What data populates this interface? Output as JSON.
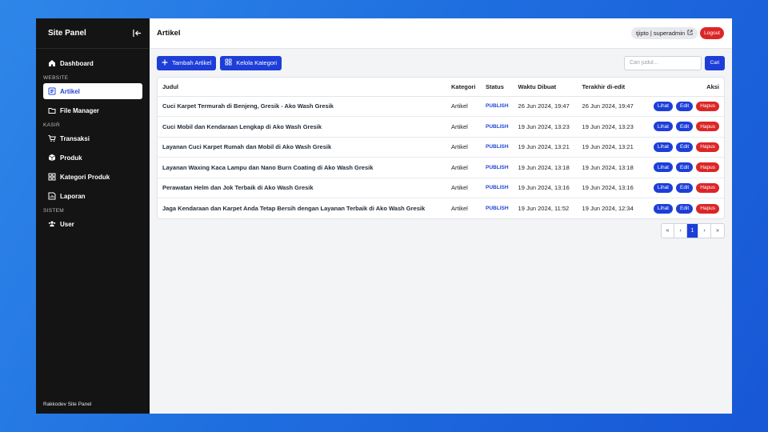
{
  "sidebar": {
    "title": "Site Panel",
    "items": [
      {
        "label": "Dashboard",
        "icon": "home-icon"
      },
      {
        "section": "WEBSITE"
      },
      {
        "label": "Artikel",
        "icon": "article-icon",
        "active": true
      },
      {
        "label": "File Manager",
        "icon": "folder-icon"
      },
      {
        "section": "KASIR"
      },
      {
        "label": "Transaksi",
        "icon": "cart-icon"
      },
      {
        "label": "Produk",
        "icon": "box-icon"
      },
      {
        "label": "Kategori Produk",
        "icon": "grid-icon"
      },
      {
        "label": "Laporan",
        "icon": "report-icon"
      },
      {
        "section": "SISTEM"
      },
      {
        "label": "User",
        "icon": "users-icon"
      }
    ],
    "footer": "Rakkodev Site Panel"
  },
  "header": {
    "title": "Artikel",
    "user": "tjipto | superadmin",
    "logout_label": "Logout"
  },
  "toolbar": {
    "add_label": "Tambah Artikel",
    "category_label": "Kelola Kategori",
    "search_placeholder": "Cari judul...",
    "search_button": "Cari"
  },
  "table": {
    "columns": [
      "Judul",
      "Kategori",
      "Status",
      "Waktu Dibuat",
      "Terakhir di-edit",
      "Aksi"
    ],
    "rows": [
      {
        "judul": "Cuci Karpet Termurah di Benjeng, Gresik - Ako Wash Gresik",
        "kategori": "Artikel",
        "status": "PUBLISH",
        "dibuat": "26 Jun 2024, 19:47",
        "diedit": "26 Jun 2024, 19:47"
      },
      {
        "judul": "Cuci Mobil dan Kendaraan Lengkap di Ako Wash Gresik",
        "kategori": "Artikel",
        "status": "PUBLISH",
        "dibuat": "19 Jun 2024, 13:23",
        "diedit": "19 Jun 2024, 13:23"
      },
      {
        "judul": "Layanan Cuci Karpet Rumah dan Mobil di Ako Wash Gresik",
        "kategori": "Artikel",
        "status": "PUBLISH",
        "dibuat": "19 Jun 2024, 13:21",
        "diedit": "19 Jun 2024, 13:21"
      },
      {
        "judul": "Layanan Waxing Kaca Lampu dan Nano Burn Coating di Ako Wash Gresik",
        "kategori": "Artikel",
        "status": "PUBLISH",
        "dibuat": "19 Jun 2024, 13:18",
        "diedit": "19 Jun 2024, 13:18"
      },
      {
        "judul": "Perawatan Helm dan Jok Terbaik di Ako Wash Gresik",
        "kategori": "Artikel",
        "status": "PUBLISH",
        "dibuat": "19 Jun 2024, 13:16",
        "diedit": "19 Jun 2024, 13:16"
      },
      {
        "judul": "Jaga Kendaraan dan Karpet Anda Tetap Bersih dengan Layanan Terbaik di Ako Wash Gresik",
        "kategori": "Artikel",
        "status": "PUBLISH",
        "dibuat": "19 Jun 2024, 11:52",
        "diedit": "19 Jun 2024, 12:34"
      }
    ],
    "actions": {
      "view": "Lihat",
      "edit": "Edit",
      "delete": "Hapus"
    }
  },
  "pagination": {
    "first": "«",
    "prev": "‹",
    "current": "1",
    "next": "›",
    "last": "»"
  },
  "colors": {
    "primary": "#1d3ed8",
    "danger": "#dc2626",
    "sidebar_bg": "#141414"
  }
}
